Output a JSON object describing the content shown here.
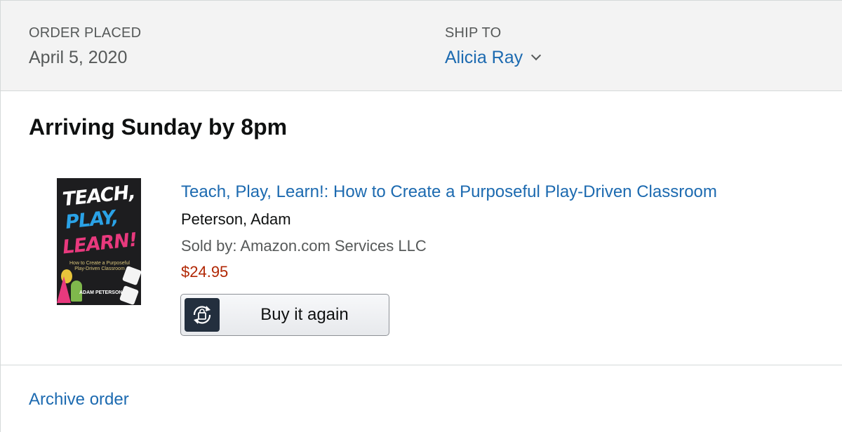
{
  "header": {
    "order_placed_label": "ORDER PLACED",
    "order_placed_value": "April 5, 2020",
    "ship_to_label": "SHIP TO",
    "ship_to_value": "Alicia Ray"
  },
  "shipment": {
    "status": "Arriving Sunday by 8pm"
  },
  "item": {
    "title": "Teach, Play, Learn!: How to Create a Purposeful Play-Driven Classroom",
    "author": "Peterson, Adam",
    "sold_by": "Sold by: Amazon.com Services LLC",
    "price": "$24.95",
    "cover": {
      "line1": "TEACH,",
      "line2": "PLAY,",
      "line3": "LEARN!",
      "subtitle": "How to Create a Purposeful Play-Driven Classroom",
      "author": "ADAM PETERSON"
    },
    "buy_again_label": "Buy it again",
    "buy_again_icon": "rebuy-bag-icon"
  },
  "footer": {
    "archive_label": "Archive order"
  },
  "colors": {
    "link": "#1c6ab0",
    "price": "#b12704",
    "header_bg": "#f3f3f3",
    "text_secondary": "#565959"
  }
}
